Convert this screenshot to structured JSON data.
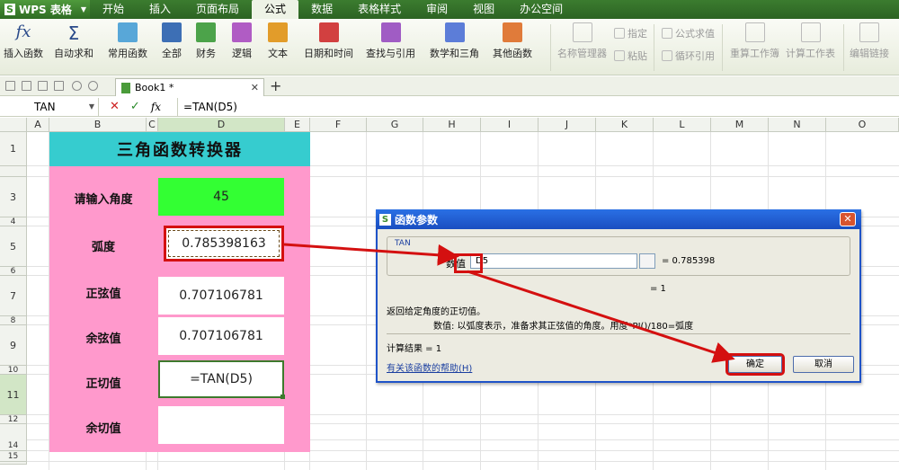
{
  "app": {
    "name": "WPS 表格"
  },
  "menu_tabs": [
    "开始",
    "插入",
    "页面布局",
    "公式",
    "数据",
    "表格样式",
    "审阅",
    "视图",
    "办公空间"
  ],
  "ribbon": {
    "insert_function": "插入函数",
    "autosum": "自动求和",
    "common": "常用函数",
    "all": "全部",
    "finance": "财务",
    "logic": "逻辑",
    "text": "文本",
    "datetime": "日期和时间",
    "lookup": "查找与引用",
    "math": "数学和三角",
    "other": "其他函数",
    "name_manager": "名称管理器",
    "assign": "指定",
    "paste": "粘贴",
    "formula_eval": "公式求值",
    "circular": "循环引用",
    "recalc_book": "重算工作簿",
    "calc_sheet": "计算工作表",
    "edit_links": "编辑链接"
  },
  "doc_tab": {
    "name": "Book1 *"
  },
  "formula_bar": {
    "name_box": "TAN",
    "fx": "fx",
    "formula": "=TAN(D5)"
  },
  "columns": [
    "A",
    "B",
    "C",
    "D",
    "E",
    "F",
    "G",
    "H",
    "I",
    "J",
    "K",
    "L",
    "M",
    "N",
    "O"
  ],
  "rows": [
    "1",
    "",
    "3",
    "4",
    "5",
    "6",
    "7",
    "8",
    "9",
    "10",
    "11",
    "12",
    "13",
    "14",
    "15"
  ],
  "sheet": {
    "title": "三角函数转换器",
    "angle_label": "请输入角度",
    "angle_value": "45",
    "radian_label": "弧度",
    "radian_value": "0.785398163",
    "sin_label": "正弦值",
    "sin_value": "0.707106781",
    "cos_label": "余弦值",
    "cos_value": "0.707106781",
    "tan_label": "正切值",
    "tan_value": "=TAN(D5)",
    "cot_label": "余切值",
    "cot_value": ""
  },
  "dialog": {
    "title": "函数参数",
    "function_name": "TAN",
    "arg_label": "数值",
    "arg_value": "D5",
    "arg_result": "= 0.785398",
    "result_eq": "= 1",
    "description": "返回给定角度的正切值。",
    "arg_description": "数值:  以弧度表示，准备求其正弦值的角度。用度*PI()/180=弧度",
    "calc_result": "计算结果 = 1",
    "help_link": "有关该函数的帮助(H)",
    "ok": "确定",
    "cancel": "取消"
  },
  "colors": {
    "title_bg": "#36cccf",
    "pink": "#ff99cc",
    "green_input": "#33ff33",
    "highlight": "#d41010",
    "menubar": "#2f6c24"
  }
}
